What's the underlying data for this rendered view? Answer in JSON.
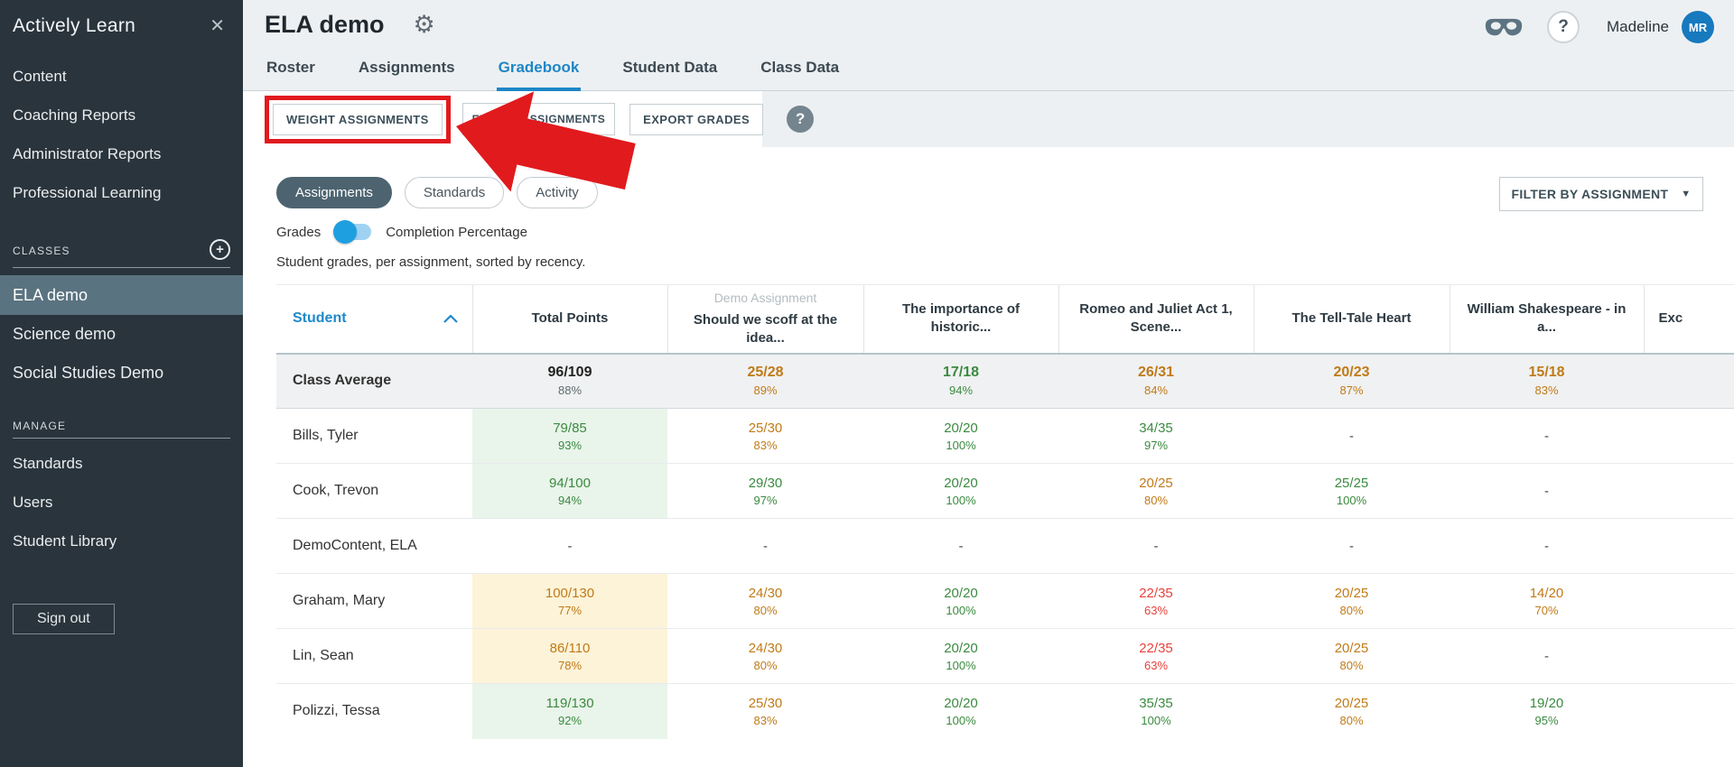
{
  "sidebar": {
    "brand": "Actively Learn",
    "close_icon": "✕",
    "nav": [
      "Content",
      "Coaching Reports",
      "Administrator Reports",
      "Professional Learning"
    ],
    "classes_label": "CLASSES",
    "classes": [
      "ELA demo",
      "Science demo",
      "Social Studies Demo"
    ],
    "active_class": "ELA demo",
    "manage_label": "MANAGE",
    "manage": [
      "Standards",
      "Users",
      "Student Library"
    ],
    "sign_out": "Sign out"
  },
  "header": {
    "title": "ELA demo",
    "tabs": [
      "Roster",
      "Assignments",
      "Gradebook",
      "Student Data",
      "Class Data"
    ],
    "active_tab": "Gradebook",
    "user_name": "Madeline",
    "avatar_initials": "MR"
  },
  "toolbar": {
    "weight_button": "WEIGHT ASSIGNMENTS",
    "excuse_button": "EXCUSE ASSIGNMENTS",
    "export_button": "EXPORT GRADES",
    "help_icon": "?"
  },
  "annotation": {
    "type": "red-highlight-box-and-arrow",
    "target": "WEIGHT ASSIGNMENTS",
    "color": "#e11a1d"
  },
  "controls": {
    "pills": [
      "Assignments",
      "Standards",
      "Activity"
    ],
    "active_pill": "Assignments",
    "toggle_left": "Grades",
    "toggle_right": "Completion Percentage",
    "toggle_state": "left",
    "caption": "Student grades, per assignment, sorted by recency.",
    "filter_button": "FILTER BY ASSIGNMENT"
  },
  "table": {
    "student_col": "Student",
    "sort": "ascending",
    "columns": [
      {
        "top": "",
        "label": "Total Points"
      },
      {
        "top": "Demo Assignment",
        "label": "Should we scoff at the idea..."
      },
      {
        "top": "",
        "label": "The importance of historic..."
      },
      {
        "top": "",
        "label": "Romeo and Juliet Act 1, Scene..."
      },
      {
        "top": "",
        "label": "The Tell-Tale Heart"
      },
      {
        "top": "",
        "label": "William Shakespeare - in a..."
      },
      {
        "top": "",
        "label": "Exc"
      }
    ],
    "rows": [
      {
        "name": "Class Average",
        "is_average": true,
        "cells": [
          {
            "v": "96/109",
            "p": "88%",
            "c": "dark"
          },
          {
            "v": "25/28",
            "p": "89%",
            "c": "orange"
          },
          {
            "v": "17/18",
            "p": "94%",
            "c": "green"
          },
          {
            "v": "26/31",
            "p": "84%",
            "c": "orange"
          },
          {
            "v": "20/23",
            "p": "87%",
            "c": "orange"
          },
          {
            "v": "15/18",
            "p": "83%",
            "c": "orange"
          },
          {
            "v": "",
            "p": "",
            "c": "dark"
          }
        ]
      },
      {
        "name": "Bills, Tyler",
        "cells": [
          {
            "v": "79/85",
            "p": "93%",
            "c": "green",
            "bg": "green"
          },
          {
            "v": "25/30",
            "p": "83%",
            "c": "orange"
          },
          {
            "v": "20/20",
            "p": "100%",
            "c": "green"
          },
          {
            "v": "34/35",
            "p": "97%",
            "c": "green"
          },
          {
            "v": "-",
            "p": "",
            "c": "dash"
          },
          {
            "v": "-",
            "p": "",
            "c": "dash"
          },
          {
            "v": "",
            "p": "",
            "c": "dash"
          }
        ]
      },
      {
        "name": "Cook, Trevon",
        "cells": [
          {
            "v": "94/100",
            "p": "94%",
            "c": "green",
            "bg": "green"
          },
          {
            "v": "29/30",
            "p": "97%",
            "c": "green"
          },
          {
            "v": "20/20",
            "p": "100%",
            "c": "green"
          },
          {
            "v": "20/25",
            "p": "80%",
            "c": "orange"
          },
          {
            "v": "25/25",
            "p": "100%",
            "c": "green"
          },
          {
            "v": "-",
            "p": "",
            "c": "dash"
          },
          {
            "v": "",
            "p": "",
            "c": "dash"
          }
        ]
      },
      {
        "name": "DemoContent, ELA",
        "cells": [
          {
            "v": "-",
            "p": "",
            "c": "dash"
          },
          {
            "v": "-",
            "p": "",
            "c": "dash"
          },
          {
            "v": "-",
            "p": "",
            "c": "dash"
          },
          {
            "v": "-",
            "p": "",
            "c": "dash"
          },
          {
            "v": "-",
            "p": "",
            "c": "dash"
          },
          {
            "v": "-",
            "p": "",
            "c": "dash"
          },
          {
            "v": "",
            "p": "",
            "c": "dash"
          }
        ]
      },
      {
        "name": "Graham, Mary",
        "cells": [
          {
            "v": "100/130",
            "p": "77%",
            "c": "orange",
            "bg": "yellow"
          },
          {
            "v": "24/30",
            "p": "80%",
            "c": "orange"
          },
          {
            "v": "20/20",
            "p": "100%",
            "c": "green"
          },
          {
            "v": "22/35",
            "p": "63%",
            "c": "red"
          },
          {
            "v": "20/25",
            "p": "80%",
            "c": "orange"
          },
          {
            "v": "14/20",
            "p": "70%",
            "c": "orange"
          },
          {
            "v": "",
            "p": "",
            "c": "dash"
          }
        ]
      },
      {
        "name": "Lin, Sean",
        "cells": [
          {
            "v": "86/110",
            "p": "78%",
            "c": "orange",
            "bg": "yellow"
          },
          {
            "v": "24/30",
            "p": "80%",
            "c": "orange"
          },
          {
            "v": "20/20",
            "p": "100%",
            "c": "green"
          },
          {
            "v": "22/35",
            "p": "63%",
            "c": "red"
          },
          {
            "v": "20/25",
            "p": "80%",
            "c": "orange"
          },
          {
            "v": "-",
            "p": "",
            "c": "dash"
          },
          {
            "v": "",
            "p": "",
            "c": "dash"
          }
        ]
      },
      {
        "name": "Polizzi, Tessa",
        "cells": [
          {
            "v": "119/130",
            "p": "92%",
            "c": "green",
            "bg": "green"
          },
          {
            "v": "25/30",
            "p": "83%",
            "c": "orange"
          },
          {
            "v": "20/20",
            "p": "100%",
            "c": "green"
          },
          {
            "v": "35/35",
            "p": "100%",
            "c": "green"
          },
          {
            "v": "20/25",
            "p": "80%",
            "c": "orange"
          },
          {
            "v": "19/20",
            "p": "95%",
            "c": "green"
          },
          {
            "v": "",
            "p": "",
            "c": "dash"
          }
        ]
      }
    ]
  },
  "colors": {
    "accent_blue": "#1e86c7",
    "grade_green": "#3a8a3f",
    "grade_orange": "#c07a18",
    "grade_red": "#e8423c",
    "bg_green": "#e9f4ea",
    "bg_yellow": "#fdf3d8",
    "sidebar_bg": "#2a343c",
    "sidebar_active": "#5a7380",
    "avatar_blue": "#1779be",
    "annotation_red": "#e11a1d"
  }
}
